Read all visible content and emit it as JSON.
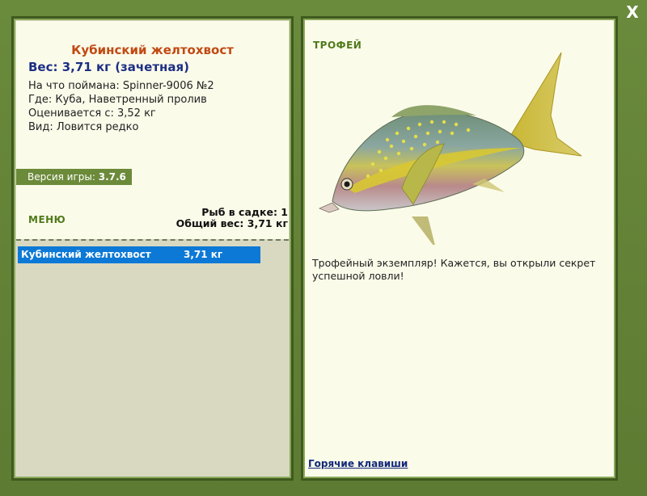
{
  "close": {
    "label": "X"
  },
  "left": {
    "fish_title": "Кубинский желтохвост",
    "weight_line": "Вес: 3,71 кг (зачетная)",
    "details": [
      "На что поймана: Spinner-9006 №2",
      "Где: Куба, Наветренный пролив",
      "Оценивается с: 3,52 кг",
      "Вид: Ловится редко"
    ],
    "version_label": "Версия игры:",
    "version_value": "3.7.6",
    "menu_label": "МЕНЮ",
    "stats": {
      "fish_in_cage": "Рыб в садке: 1",
      "total_weight": "Общий вес: 3,71 кг"
    },
    "catch_list": [
      {
        "name": "Кубинский желтохвост",
        "weight": "3,71 кг"
      }
    ]
  },
  "right": {
    "trophy_label": "ТРОФЕЙ",
    "description": "Трофейный экземпляр! Кажется, вы открыли секрет успешной ловли!",
    "hotkeys_link": "Горячие клавиши"
  },
  "colors": {
    "frame": "#5f7d35",
    "title": "#c14a12",
    "weight": "#1c2f84",
    "selected_row": "#0d79d6",
    "menu_green": "#4f7a1a"
  }
}
